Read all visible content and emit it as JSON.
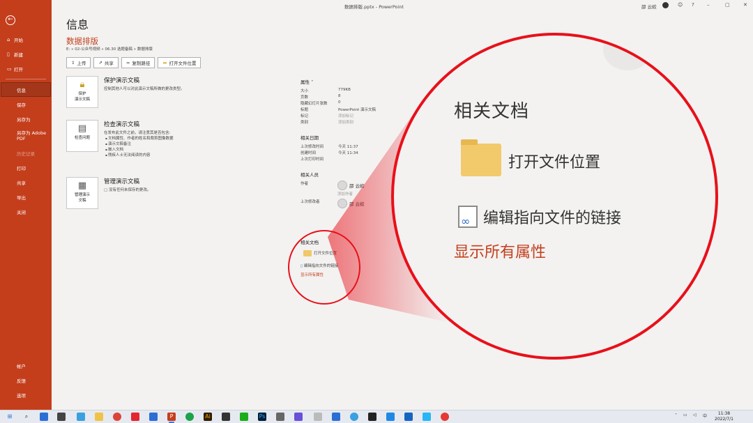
{
  "window": {
    "title": "数据排版.pptx  -  PowerPoint",
    "user": "邵 云蛟"
  },
  "sidebar": {
    "back_icon": "arrow-left-icon",
    "items": [
      {
        "label": "开始",
        "icon": "home-icon",
        "state": "normal"
      },
      {
        "label": "新建",
        "icon": "new-file-icon",
        "state": "normal"
      },
      {
        "label": "打开",
        "icon": "folder-open-icon",
        "state": "normal"
      },
      {
        "label": "信息",
        "state": "active"
      },
      {
        "label": "保存",
        "state": "normal"
      },
      {
        "label": "另存为",
        "state": "normal"
      },
      {
        "label": "另存为 Adobe PDF",
        "state": "normal"
      },
      {
        "label": "历史记录",
        "state": "disabled"
      },
      {
        "label": "打印",
        "state": "normal"
      },
      {
        "label": "共享",
        "state": "normal"
      },
      {
        "label": "导出",
        "state": "normal"
      },
      {
        "label": "关闭",
        "state": "normal"
      }
    ],
    "bottom": [
      {
        "label": "帐户"
      },
      {
        "label": "反馈"
      },
      {
        "label": "选项"
      }
    ]
  },
  "info": {
    "page_title": "信息",
    "doc_title": "数据排版",
    "doc_path": "E: » 02-公众号视频 » 06.30 选题备稿 » 数据排版",
    "actions": [
      {
        "label": "上传",
        "icon": "upload-icon"
      },
      {
        "label": "共享",
        "icon": "share-icon"
      },
      {
        "label": "复制路径",
        "icon": "link-icon"
      },
      {
        "label": "打开文件位置",
        "icon": "folder-icon"
      }
    ],
    "protect": {
      "icon_label": "保护\n演示文稿",
      "title": "保护演示文稿",
      "desc": "控制其他人可以对此演示文稿所做的更改类型。"
    },
    "inspect": {
      "icon_label": "检查问题",
      "title": "检查演示文稿",
      "desc": "在发布此文件之前，请注意其是否包含:",
      "bullets": [
        "文档属性、作者的姓名和裁剪图像数据",
        "演示文稿备注",
        "嵌入文档",
        "残疾人士无法阅读的内容"
      ]
    },
    "manage": {
      "icon_label": "管理演示\n文稿",
      "title": "管理演示文稿",
      "desc": "没有任何未保存的更改。"
    }
  },
  "properties": {
    "heading": "属性",
    "rows": [
      {
        "k": "大小",
        "v": "779KB"
      },
      {
        "k": "页数",
        "v": "8"
      },
      {
        "k": "隐藏幻灯片张数",
        "v": "0"
      },
      {
        "k": "标题",
        "v": "PowerPoint 演示文稿"
      },
      {
        "k": "标记",
        "v": "添加标记",
        "muted": true
      },
      {
        "k": "类别",
        "v": "添加类别",
        "muted": true
      }
    ],
    "dates_heading": "相关日期",
    "dates": [
      {
        "k": "上次修改时间",
        "v": "今天 11:37"
      },
      {
        "k": "创建时间",
        "v": "今天 11:34"
      },
      {
        "k": "上次打印时间",
        "v": ""
      }
    ],
    "people_heading": "相关人员",
    "author_label": "作者",
    "author": "邵 云蛟",
    "add_author": "添加作者",
    "last_modified_by_label": "上次修改者",
    "last_modified_by": "邵 云蛟"
  },
  "related": {
    "heading": "相关文档",
    "open_location": "打开文件位置",
    "edit_links": "编辑指向文件的链接",
    "show_all": "显示所有属性"
  },
  "taskbar": {
    "time": "11:38",
    "date": "2022/7/1"
  },
  "colors": {
    "accent": "#c43e1c",
    "highlight": "#e8101a",
    "folder": "#f2c96b"
  }
}
